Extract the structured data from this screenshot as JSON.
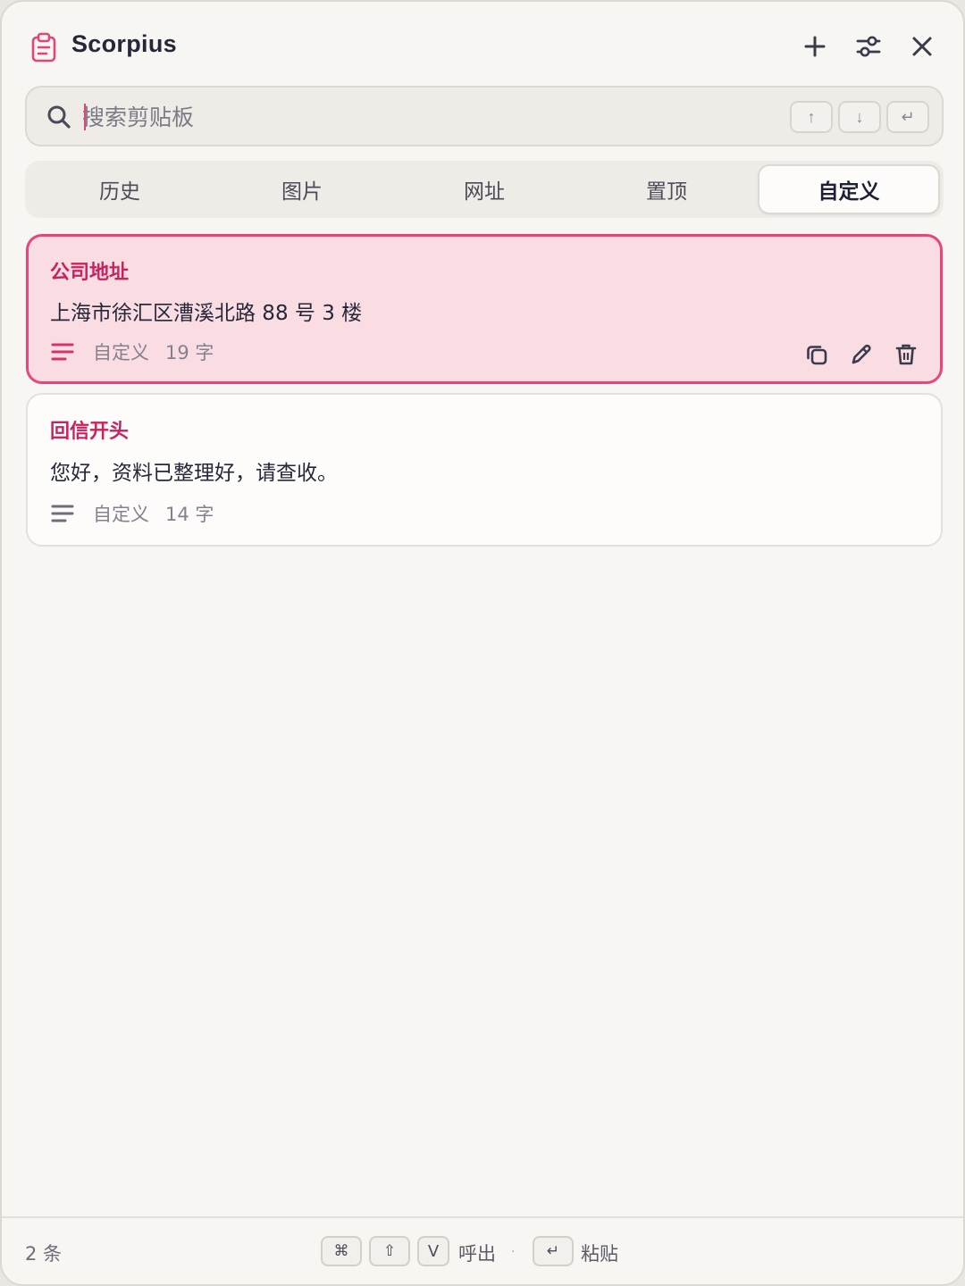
{
  "app": {
    "title": "Scorpius",
    "icon": "clipboard-icon",
    "accent_color": "#e0457b"
  },
  "titlebar": {
    "buttons": [
      "plus-icon",
      "sliders-icon",
      "close-icon"
    ]
  },
  "search": {
    "placeholder": "搜索剪贴板",
    "value": "",
    "keys": {
      "up": "↑",
      "down": "↓",
      "enter": "↵"
    }
  },
  "tabs": [
    {
      "label": "历史",
      "active": false
    },
    {
      "label": "图片",
      "active": false
    },
    {
      "label": "网址",
      "active": false
    },
    {
      "label": "置顶",
      "active": false
    },
    {
      "label": "自定义",
      "active": true
    }
  ],
  "items": [
    {
      "title": "公司地址",
      "text": "上海市徐汇区漕溪北路 88 号 3 楼",
      "kind": "自定义",
      "chars": "19 字",
      "selected": true
    },
    {
      "title": "回信开头",
      "text": "您好，资料已整理好，请查收。",
      "kind": "自定义",
      "chars": "14 字",
      "selected": false
    }
  ],
  "footer": {
    "count": "2 条",
    "summon_keys": {
      "cmd": "⌘",
      "shift": "⇧",
      "v": "V"
    },
    "summon_label": "呼出",
    "separator": "·",
    "paste_key": "↵",
    "paste_label": "粘贴"
  }
}
